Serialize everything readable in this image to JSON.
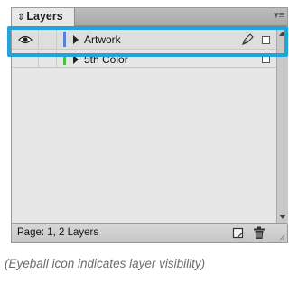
{
  "panel": {
    "tab_label": "Layers",
    "tab_arrows": "⇕",
    "menu_icon": "▾≡"
  },
  "layers": [
    {
      "name": "Artwork",
      "visible": true,
      "color": "#5b7fd6",
      "has_pen": true
    },
    {
      "name": "5th Color",
      "visible": false,
      "color": "#4cc040",
      "has_pen": false
    }
  ],
  "footer": {
    "status": "Page: 1, 2 Layers"
  },
  "caption": "(Eyeball icon indicates layer visibility)",
  "colors": {
    "highlight": "#22a3da"
  }
}
